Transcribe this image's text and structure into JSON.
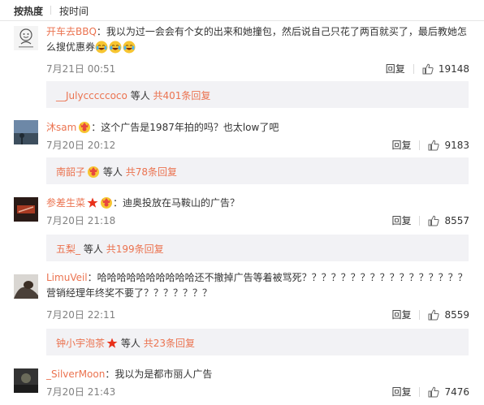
{
  "sort": {
    "hot": "按热度",
    "time": "按时间"
  },
  "comments": [
    {
      "user": "开车去BBQ",
      "text": "：我以为过一会会有个女的出来和她撞包，然后说自己只花了两百就买了，最后教她怎么搜优惠券",
      "time": "7月21日 00:51",
      "reply": "回复",
      "likes": "19148",
      "sub": {
        "user": "__Julycccccoco",
        "mid": "等人",
        "count": "共401条回复"
      }
    },
    {
      "user": "沐sam",
      "text": "：这个广告是1987年拍的吗？也太low了吧",
      "time": "7月20日 20:12",
      "reply": "回复",
      "likes": "9183",
      "sub": {
        "user": "南韶子",
        "mid": "等人",
        "count": "共78条回复"
      }
    },
    {
      "user": "参差生菜",
      "text": "：迪奥投放在马鞍山的广告？",
      "time": "7月20日 21:18",
      "reply": "回复",
      "likes": "8557",
      "sub": {
        "user": "五梨_",
        "mid": "等人",
        "count": "共199条回复"
      }
    },
    {
      "user": "LimuVeil",
      "text": "：哈哈哈哈哈哈哈哈哈哈还不撤掉广告等着被骂死？？？？？？？？？？？？？？？？？营销经理年终奖不要了？？？？？？？",
      "time": "7月20日 22:11",
      "reply": "回复",
      "likes": "8559",
      "sub": {
        "user": "钟小宇泡茶",
        "mid": "等人",
        "count": "共23条回复"
      }
    },
    {
      "user": "_SilverMoon",
      "text": "：我以为是都市丽人广告",
      "time": "7月20日 21:43",
      "reply": "回复",
      "likes": "7476"
    }
  ],
  "icons": {
    "like": "thumbs-up-icon",
    "vip": "vip-crown-badge",
    "star": "red-star-badge",
    "laugh": "laugh-cry-emoji"
  },
  "colors": {
    "name": "#eb7350",
    "sub_bg": "#f2f2f5",
    "meta": "#808080"
  }
}
